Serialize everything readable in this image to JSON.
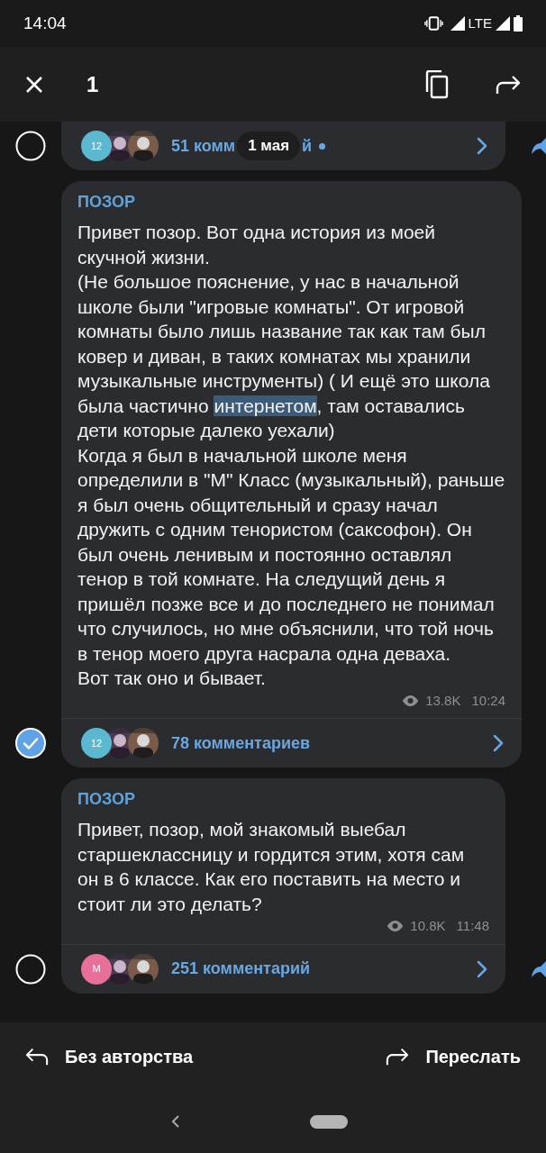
{
  "status_bar": {
    "time": "14:04",
    "network": "LTE"
  },
  "header": {
    "count": "1"
  },
  "date_pill": "1 мая",
  "messages": [
    {
      "kind": "partial",
      "selected": false,
      "forward_button": true,
      "comments": {
        "text": "51 комм",
        "tail": "й",
        "unread": true,
        "avatars": [
          {
            "kind": "letter",
            "text": "12",
            "color": "#5bb8d0"
          },
          {
            "kind": "picture"
          },
          {
            "kind": "picture"
          }
        ]
      }
    },
    {
      "kind": "full",
      "selected": true,
      "author": "ПОЗОР",
      "forward_button": false,
      "segments": [
        {
          "text": "Привет позор. Вот одна история из моей скучной жизни.\n(Не большое пояснение, у нас в начальной школе были \"игровые комнаты\". От игровой комнаты было лишь название так как там был ковер и диван, в таких комнатах мы хранили музыкальные инструменты) ( И ещё это школа была частично ",
          "selected": false
        },
        {
          "text": "интернетом",
          "selected": true
        },
        {
          "text": ", там оставались дети которые далеко уехали)\nКогда я был в начальной школе меня определили в \"М\" Класс (музыкальный), раньше я был очень общительный и сразу начал дружить с одним тенористом (саксофон). Он был очень ленивым и постоянно оставлял тенор в той комнате. На следущий день я пришёл позже все и до последнего не понимал что случилось, но мне объяснили, что той ночь в тенор моего друга насрала одна деваха.\nВот так оно и бывает.",
          "selected": false
        }
      ],
      "views": "13.8K",
      "time": "10:24",
      "comments": {
        "text": "78 комментариев",
        "unread": false,
        "avatars": [
          {
            "kind": "letter",
            "text": "12",
            "color": "#5bb8d0"
          },
          {
            "kind": "picture"
          },
          {
            "kind": "picture"
          }
        ]
      }
    },
    {
      "kind": "full",
      "selected": false,
      "author": "ПОЗОР",
      "forward_button": true,
      "segments": [
        {
          "text": "Привет, позор, мой знакомый выебал старшеклассницу и гордится этим, хотя сам он в 6 классе. Как его поставить на место и стоит ли это делать?",
          "selected": false
        }
      ],
      "views": "10.8K",
      "time": "11:48",
      "comments": {
        "text": "251 комментарий",
        "unread": false,
        "avatars": [
          {
            "kind": "letter",
            "text": "M",
            "color": "#e86f9a"
          },
          {
            "kind": "picture"
          },
          {
            "kind": "picture"
          }
        ]
      }
    }
  ],
  "bottom_bar": {
    "left": "Без авторства",
    "right": "Переслать"
  }
}
